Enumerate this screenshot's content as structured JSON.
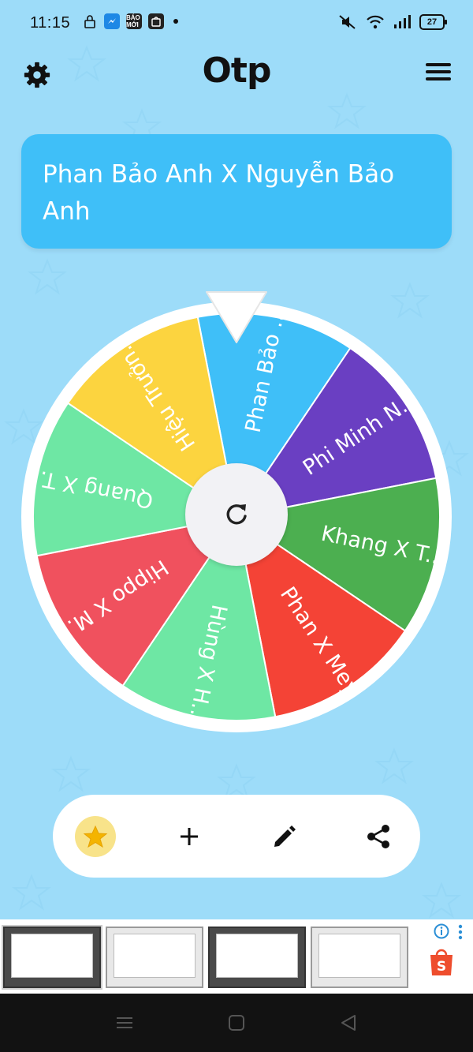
{
  "status_bar": {
    "time": "11:15",
    "left_icons": [
      "lock-icon",
      "messenger-icon",
      "baomoi-icon",
      "shopee-icon"
    ],
    "baomoi_text": "BÁO MỚI",
    "battery_level": "27"
  },
  "header": {
    "title": "Otp",
    "settings_icon": "gear-icon",
    "menu_icon": "hamburger-menu-icon"
  },
  "result": {
    "text": "Phan Bảo Anh X Nguyễn Bảo Anh"
  },
  "wheel": {
    "segments": [
      {
        "label": "Phan Bảo ...",
        "color": "#3fbff8"
      },
      {
        "label": "Phi Minh N...",
        "color": "#6a3fc2"
      },
      {
        "label": "Khang X T...",
        "color": "#4caf50"
      },
      {
        "label": "Phan X Mey",
        "color": "#f44336"
      },
      {
        "label": "Hùng X H...",
        "color": "#6ee7a4"
      },
      {
        "label": "Hippo X M...",
        "color": "#f0515e"
      },
      {
        "label": "Quang X T...",
        "color": "#6ee7a4"
      },
      {
        "label": "Hiệu Trưởn...",
        "color": "#fcd43f"
      }
    ],
    "spin_icon": "refresh-icon",
    "pointer_icon": "pointer-triangle-icon"
  },
  "toolbar": {
    "items": [
      {
        "icon": "star-icon",
        "active": true
      },
      {
        "icon": "plus-icon",
        "active": false
      },
      {
        "icon": "pencil-icon",
        "active": false
      },
      {
        "icon": "share-icon",
        "active": false
      }
    ],
    "accent": "#f8e38a"
  },
  "ad": {
    "thumbnails": [
      "laptop-screen-1",
      "laptop-screen-2",
      "laptop-screen-3",
      "laptop-screen-4"
    ],
    "info_icon": "info-icon",
    "brand_icon": "shopee-bag-icon",
    "brand_letter": "S"
  },
  "nav_bar": {
    "buttons": [
      "recent-apps-icon",
      "home-icon",
      "back-icon"
    ]
  },
  "colors": {
    "background": "#9ddcf9",
    "card": "#3fbff8"
  }
}
